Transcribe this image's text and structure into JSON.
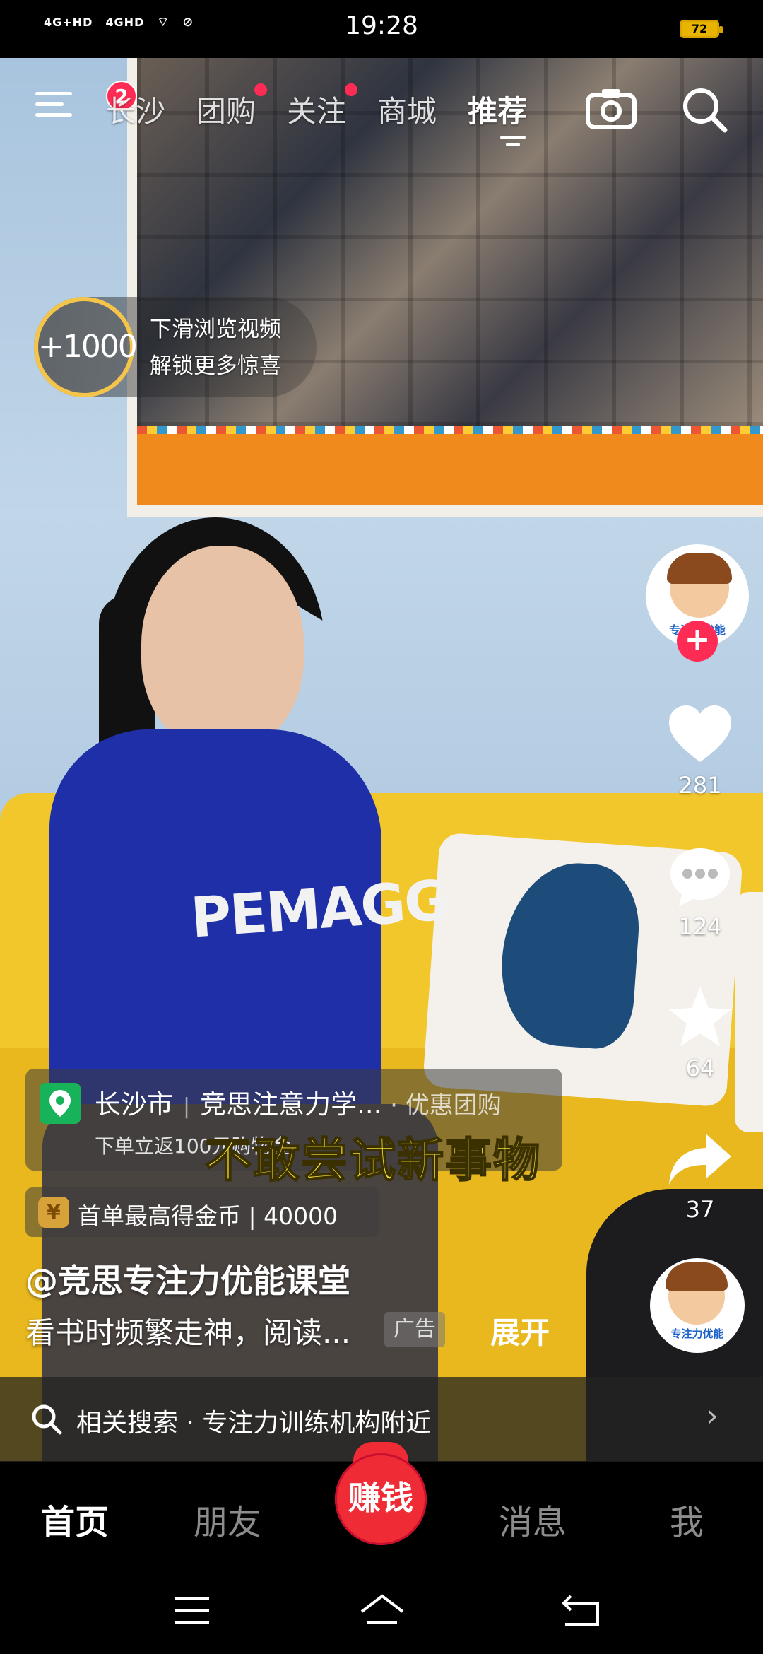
{
  "status_bar": {
    "signal1": "4G+HD",
    "signal2": "4GHD",
    "time": "19:28",
    "battery": "72"
  },
  "top_nav": {
    "notification_count": "2",
    "tabs": [
      {
        "label": "长沙",
        "active": false,
        "dot": false
      },
      {
        "label": "团购",
        "active": false,
        "dot": true
      },
      {
        "label": "关注",
        "active": false,
        "dot": true
      },
      {
        "label": "商城",
        "active": false,
        "dot": false
      },
      {
        "label": "推荐",
        "active": true,
        "dot": false
      }
    ]
  },
  "reward": {
    "coins": "+1000",
    "line1": "下滑浏览视频",
    "line2": "解锁更多惊喜"
  },
  "video": {
    "shirt_text": "PEMAGG",
    "subtitle": "不敢尝试新事物"
  },
  "right_rail": {
    "avatar_text": "专注力优能",
    "likes": "281",
    "comments": "124",
    "favorites": "64",
    "shares": "37"
  },
  "location_card": {
    "city": "长沙市",
    "store": "竞思注意力学...",
    "deal": "· 优惠团购",
    "promo": "下单立返100元购物金"
  },
  "coin_card": {
    "icon": "¥",
    "text": "首单最高得金币 | 40000"
  },
  "post": {
    "author": "@竞思专注力优能课堂",
    "description": "看书时频繁走神，阅读...",
    "ad_tag": "广告",
    "expand": "展开"
  },
  "related_search": {
    "text": "相关搜索 · 专注力训练机构附近"
  },
  "bottom_nav": {
    "home": "首页",
    "friends": "朋友",
    "earn": "赚钱",
    "messages": "消息",
    "me": "我"
  },
  "colors": {
    "accent": "#fe2c55",
    "earn": "#ef2b36",
    "coin_ring": "#f4c54a",
    "location_pin": "#18b25a"
  }
}
